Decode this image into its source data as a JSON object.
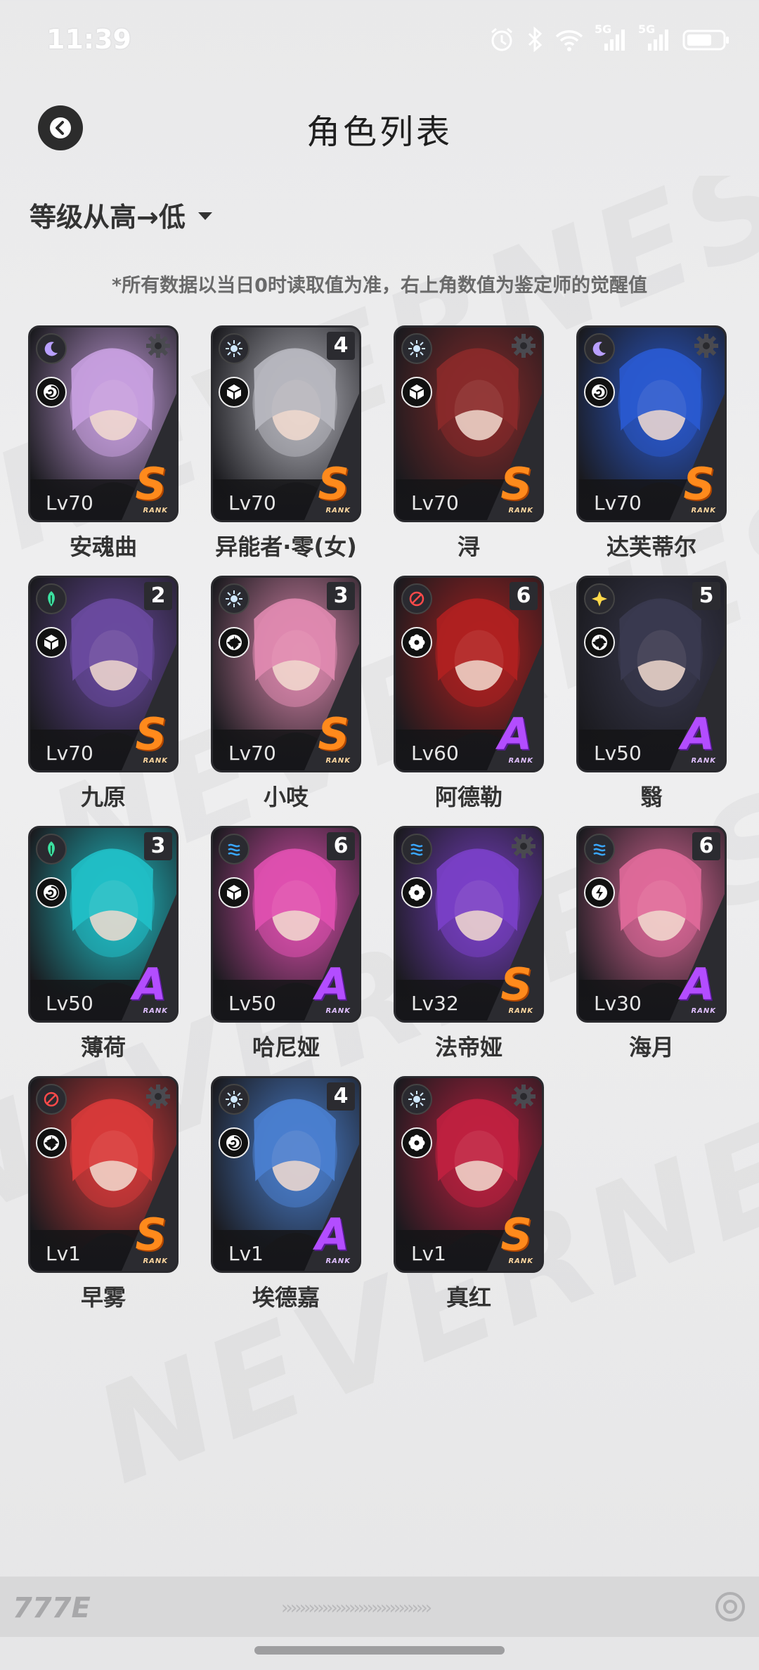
{
  "status_bar": {
    "time": "11:39",
    "net1": "5G",
    "net2": "5G"
  },
  "header": {
    "title": "角色列表"
  },
  "sort": {
    "label": "等级从高→低"
  },
  "note": "*所有数据以当日0时读取值为准，右上角数值为鉴定师的觉醒值",
  "rank_sub": "RANK",
  "characters": [
    {
      "name": "安魂曲",
      "level": "Lv70",
      "rank": "S",
      "awakening": "",
      "attr_icon": "moon-icon",
      "role_icon": "swirl-icon",
      "accent": "#c8a0e0"
    },
    {
      "name": "异能者·零(女)",
      "level": "Lv70",
      "rank": "S",
      "awakening": "4",
      "attr_icon": "sun-icon",
      "role_icon": "cube-icon",
      "accent": "#b8b8c0"
    },
    {
      "name": "浔",
      "level": "Lv70",
      "rank": "S",
      "awakening": "",
      "attr_icon": "sun-icon",
      "role_icon": "cube-icon",
      "accent": "#8a2a2a"
    },
    {
      "name": "达芙蒂尔",
      "level": "Lv70",
      "rank": "S",
      "awakening": "",
      "attr_icon": "moon-icon",
      "role_icon": "swirl-icon",
      "accent": "#2a5ad0"
    },
    {
      "name": "九原",
      "level": "Lv70",
      "rank": "S",
      "awakening": "2",
      "attr_icon": "leaf-icon",
      "role_icon": "cube-icon",
      "accent": "#6a4aa0"
    },
    {
      "name": "小吱",
      "level": "Lv70",
      "rank": "S",
      "awakening": "3",
      "attr_icon": "sun-icon",
      "role_icon": "spiral-icon",
      "accent": "#e08ab0"
    },
    {
      "name": "阿德勒",
      "level": "Lv60",
      "rank": "A",
      "awakening": "6",
      "attr_icon": "target-icon",
      "role_icon": "flower-icon",
      "accent": "#b02020"
    },
    {
      "name": "翳",
      "level": "Lv50",
      "rank": "A",
      "awakening": "5",
      "attr_icon": "star-icon",
      "role_icon": "spiral-icon",
      "accent": "#3a3a50"
    },
    {
      "name": "薄荷",
      "level": "Lv50",
      "rank": "A",
      "awakening": "3",
      "attr_icon": "leaf-icon",
      "role_icon": "swirl-icon",
      "accent": "#20c0c8"
    },
    {
      "name": "哈尼娅",
      "level": "Lv50",
      "rank": "A",
      "awakening": "6",
      "attr_icon": "wave-icon",
      "role_icon": "cube-icon",
      "accent": "#e050b0"
    },
    {
      "name": "法帝娅",
      "level": "Lv32",
      "rank": "S",
      "awakening": "",
      "attr_icon": "wave-icon",
      "role_icon": "flower-icon",
      "accent": "#7a40c8"
    },
    {
      "name": "海月",
      "level": "Lv30",
      "rank": "A",
      "awakening": "6",
      "attr_icon": "wave-icon",
      "role_icon": "bolt-icon",
      "accent": "#e06a9a"
    },
    {
      "name": "早雾",
      "level": "Lv1",
      "rank": "S",
      "awakening": "",
      "attr_icon": "target-icon",
      "role_icon": "spiral-icon",
      "accent": "#d83a3a"
    },
    {
      "name": "埃德嘉",
      "level": "Lv1",
      "rank": "A",
      "awakening": "4",
      "attr_icon": "sun-icon",
      "role_icon": "swirl-icon",
      "accent": "#4a80d0"
    },
    {
      "name": "真红",
      "level": "Lv1",
      "rank": "S",
      "awakening": "",
      "attr_icon": "sun-icon",
      "role_icon": "flower-icon",
      "accent": "#c02040"
    }
  ],
  "footer": {
    "logo": "777E"
  }
}
